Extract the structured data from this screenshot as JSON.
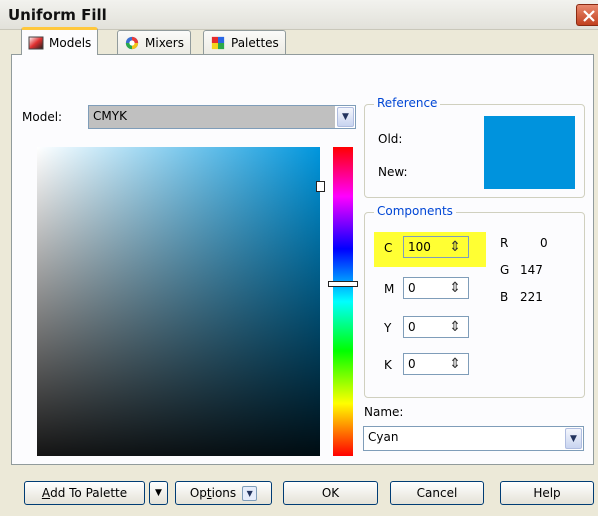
{
  "window": {
    "title": "Uniform Fill"
  },
  "tabs": [
    {
      "label": "Models",
      "active": true,
      "icon": "models-icon"
    },
    {
      "label": "Mixers",
      "active": false,
      "icon": "mixers-icon"
    },
    {
      "label": "Palettes",
      "active": false,
      "icon": "palettes-icon"
    }
  ],
  "model": {
    "label": "Model:",
    "value": "CMYK"
  },
  "reference": {
    "legend": "Reference",
    "old_label": "Old:",
    "new_label": "New:",
    "swatch_color": "#0093dd"
  },
  "components": {
    "legend": "Components",
    "c": {
      "label": "C",
      "value": "100"
    },
    "m": {
      "label": "M",
      "value": "0"
    },
    "y": {
      "label": "Y",
      "value": "0"
    },
    "k": {
      "label": "K",
      "value": "0"
    },
    "r": {
      "label": "R",
      "value": "0"
    },
    "g": {
      "label": "G",
      "value": "147"
    },
    "b": {
      "label": "B",
      "value": "221"
    },
    "highlight_color": "#ffff33"
  },
  "name": {
    "label": "Name:",
    "value": "Cyan"
  },
  "buttons": {
    "add_to_palette_prefix": "A",
    "add_to_palette_rest": "dd To Palette",
    "options_prefix": "Op",
    "options_u": "t",
    "options_rest": "ions",
    "ok": "OK",
    "cancel": "Cancel",
    "help": "Help"
  }
}
